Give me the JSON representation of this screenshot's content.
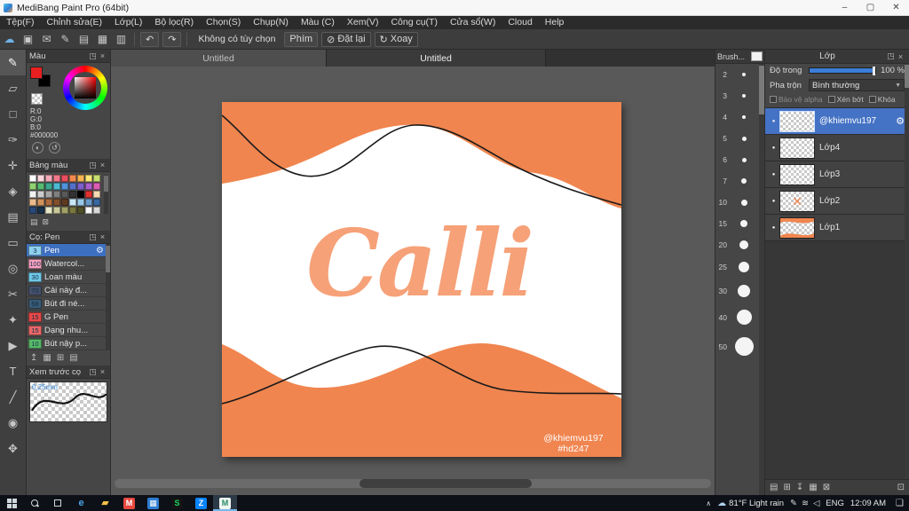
{
  "titlebar": {
    "title": "MediBang Paint Pro (64bit)",
    "minimize": "–",
    "maximize": "▢",
    "close": "✕"
  },
  "menubar": {
    "items": [
      "Tệp(F)",
      "Chỉnh sửa(E)",
      "Lớp(L)",
      "Bộ lọc(R)",
      "Chọn(S)",
      "Chụp(N)",
      "Màu (C)",
      "Xem(V)",
      "Công cụ(T)",
      "Cửa sổ(W)",
      "Cloud",
      "Help"
    ]
  },
  "toolbar": {
    "icons": [
      {
        "name": "cloud-upload-icon",
        "glyph": "☁",
        "color": "#6db3e8"
      },
      {
        "name": "save-icon",
        "glyph": "▣"
      },
      {
        "name": "comment-icon",
        "glyph": "✉"
      },
      {
        "name": "brush-settings-icon",
        "glyph": "✎"
      },
      {
        "name": "document-icon",
        "glyph": "▤"
      },
      {
        "name": "grid-icon",
        "glyph": "▦"
      },
      {
        "name": "material-icon",
        "glyph": "▥"
      }
    ],
    "undo": "↶",
    "redo": "↷",
    "no_option_label": "Không có tùy chọn",
    "keys_label": "Phím",
    "reset_icon": "⊘",
    "reset_label": "Đặt lại",
    "rotate_icon": "↻",
    "rotate_label": "Xoay"
  },
  "toolstrip": {
    "tools": [
      {
        "name": "pen-tool",
        "glyph": "✎",
        "selected": true
      },
      {
        "name": "eraser-tool",
        "glyph": "▱"
      },
      {
        "name": "dot-tool",
        "glyph": "□"
      },
      {
        "name": "brush-tool",
        "glyph": "✑"
      },
      {
        "name": "move-tool",
        "glyph": "✛"
      },
      {
        "name": "fill-tool",
        "glyph": "◈"
      },
      {
        "name": "gradient-tool",
        "glyph": "▤"
      },
      {
        "name": "select-tool",
        "glyph": "▭"
      },
      {
        "name": "ellipse-select-tool",
        "glyph": "◎"
      },
      {
        "name": "lasso-tool",
        "glyph": "✂"
      },
      {
        "name": "magic-wand-tool",
        "glyph": "✦"
      },
      {
        "name": "operation-tool",
        "glyph": "▶"
      },
      {
        "name": "text-tool",
        "glyph": "T"
      },
      {
        "name": "divide-tool",
        "glyph": "╱"
      },
      {
        "name": "eyedropper-tool",
        "glyph": "◉"
      },
      {
        "name": "hand-tool",
        "glyph": "✥"
      }
    ]
  },
  "color_panel": {
    "title": "Màu",
    "r": "R:0",
    "g": "G:0",
    "b": "B:0",
    "hex": "#000000"
  },
  "palette_panel": {
    "title": "Bảng màu",
    "colors": [
      "#ffffff",
      "#fbd5da",
      "#f6a8b8",
      "#f07a8a",
      "#ea4f5f",
      "#f2894f",
      "#f6b350",
      "#f9e676",
      "#c6de70",
      "#90d272",
      "#55ba70",
      "#3ba68e",
      "#4bbad2",
      "#5192da",
      "#5570ca",
      "#7e5eca",
      "#aa5eca",
      "#da5eb2",
      "#f2f2f2",
      "#cccccc",
      "#a6a6a6",
      "#7f7f7f",
      "#595959",
      "#333333",
      "#000000",
      "#e03030",
      "#f6dab4",
      "#eabb8c",
      "#d2925c",
      "#aa6a3c",
      "#82502c",
      "#5e3a20",
      "#c8e8f8",
      "#98c8e8",
      "#6898c8",
      "#3868a0",
      "#284878",
      "#183048",
      "#e8e8c8",
      "#c8c898",
      "#a0a068",
      "#787840",
      "#505028",
      "#f8f8f8",
      "#d8d8d8"
    ]
  },
  "brush_panel": {
    "title": "Cọ: Pen",
    "brushes": [
      {
        "size": "3",
        "name": "Pen",
        "chip": "#8fd0f0",
        "selected": true
      },
      {
        "size": "100",
        "name": "Watercol...",
        "chip": "#f8a0c0"
      },
      {
        "size": "30",
        "name": "Loan màu",
        "chip": "#70c8e8"
      },
      {
        "size": "70",
        "name": "Cải này đ...",
        "chip": "#46506a"
      },
      {
        "size": "58",
        "name": "Bút đi né...",
        "chip": "#3a5a74"
      },
      {
        "size": "15",
        "name": "G Pen",
        "chip": "#e84848"
      },
      {
        "size": "15",
        "name": "Dạng nhu...",
        "chip": "#e86868"
      },
      {
        "size": "10",
        "name": "Bút nậy p...",
        "chip": "#58b868"
      }
    ]
  },
  "preview_panel": {
    "title": "Xem trước cọ",
    "size_label": "0.25mm"
  },
  "canvas_tabs": {
    "tab1": "Untitled",
    "tab2": "Untitled"
  },
  "canvas": {
    "calli_text": "Calli",
    "calli_color": "#F6A178",
    "orange": "#F0854F",
    "watermark1": "@khiemvu197",
    "watermark2": "#hd247"
  },
  "size_panel": {
    "title": "Brush...",
    "sizes": [
      2,
      3,
      4,
      5,
      6,
      7,
      10,
      15,
      20,
      25,
      30,
      40,
      50
    ]
  },
  "layers_panel": {
    "title": "Lớp",
    "opacity_label": "Độ trong",
    "opacity_value": "100 %",
    "blend_label": "Pha trộn",
    "blend_value": "Bình thường",
    "chk1": "Bảo vệ alpha",
    "chk2": "Xén bớt",
    "chk3": "Khóa",
    "layers": [
      {
        "name": "@khiemvu197",
        "selected": true,
        "thumb": "plain"
      },
      {
        "name": "Lớp4",
        "thumb": "plain"
      },
      {
        "name": "Lớp3",
        "thumb": "plain"
      },
      {
        "name": "Lớp2",
        "thumb": "cross"
      },
      {
        "name": "Lớp1",
        "thumb": "waves"
      }
    ]
  },
  "taskbar": {
    "icons": [
      {
        "name": "edge",
        "glyph": "e",
        "fg": "#4aa3e8"
      },
      {
        "name": "file-explorer",
        "glyph": "▰",
        "fg": "#f2c14a"
      },
      {
        "name": "mail",
        "glyph": "M",
        "fg": "#ffffff",
        "bg": "#e8483f"
      },
      {
        "name": "photos",
        "glyph": "▦",
        "fg": "#ffffff",
        "bg": "#2d7dd2"
      },
      {
        "name": "spotify",
        "glyph": "S",
        "fg": "#1ed760",
        "bg": "#141414"
      },
      {
        "name": "zalo",
        "glyph": "Z",
        "fg": "#ffffff",
        "bg": "#0a84ff"
      },
      {
        "name": "medibang",
        "glyph": "M",
        "fg": "#2a8a6a",
        "bg": "#eef6f0",
        "active": true
      }
    ],
    "tray": {
      "chevron": "∧",
      "weather_icon": "☁",
      "weather": "81°F Light rain",
      "icons": [
        {
          "name": "pen-input",
          "glyph": "✎"
        },
        {
          "name": "network",
          "glyph": "≋"
        },
        {
          "name": "volume",
          "glyph": "◁"
        }
      ],
      "lang": "ENG",
      "time": "12:09 AM",
      "notif": "❑"
    }
  }
}
